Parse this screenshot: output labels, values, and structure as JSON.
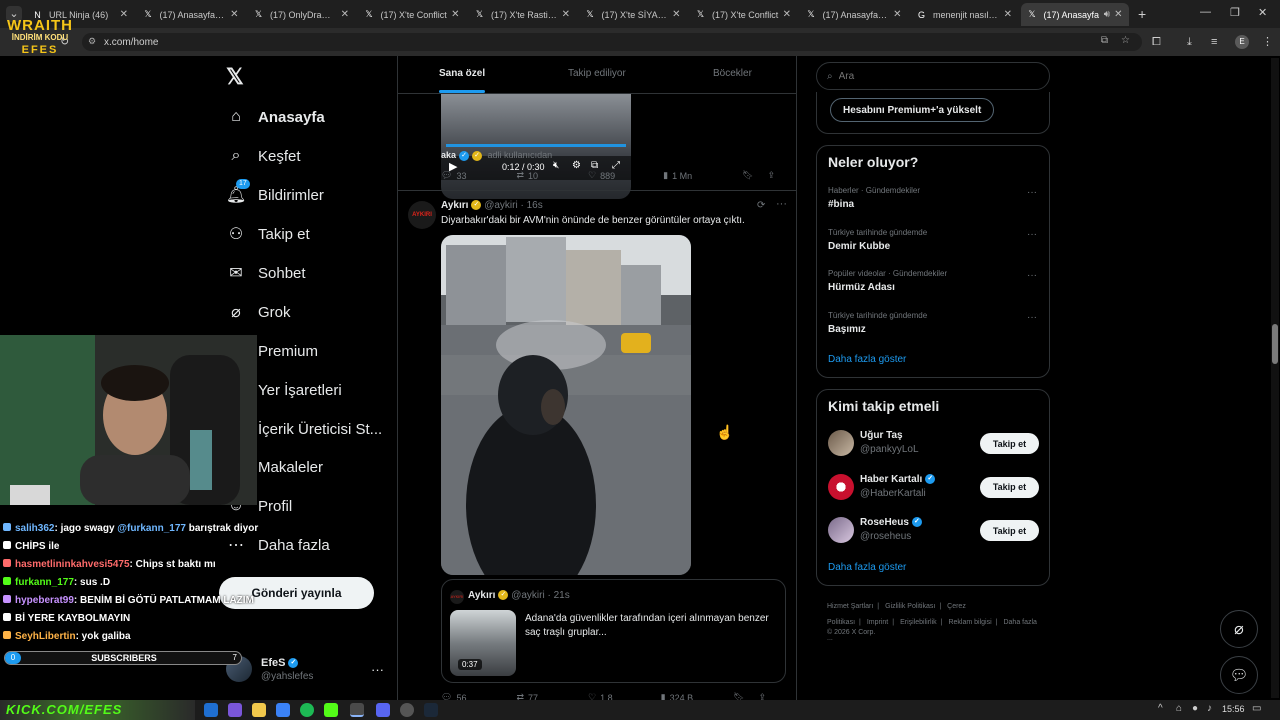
{
  "browser": {
    "tabs": [
      {
        "title": "URL Ninja (46)",
        "active": false
      },
      {
        "title": "(17) Anasayfa / X",
        "active": false
      },
      {
        "title": "(17) OnlyDrama (",
        "active": false
      },
      {
        "title": "(17) X'te Conflict",
        "active": false
      },
      {
        "title": "(17) X'te Rasti Hal",
        "active": false
      },
      {
        "title": "(17) X'te SİYAH Sİ",
        "active": false
      },
      {
        "title": "(17) X'te Conflict",
        "active": false
      },
      {
        "title": "(17) Anasayfa / X",
        "active": false
      },
      {
        "title": "menenjit nasıl bir",
        "active": false
      },
      {
        "title": "(17) Anasayfa",
        "active": true
      }
    ],
    "new_tab": "+",
    "url": "x.com/home",
    "profile_initial": "E"
  },
  "overlay": {
    "brand_line1": "WRAITH",
    "brand_line2": "İNDİRİM KODU",
    "brand_line3": "EFES",
    "subscribers_label": "SUBSCRIBERS",
    "subscribers_left": "0",
    "subscribers_right": "7",
    "bottom_banner": "KICK.COM/EFES",
    "chat": [
      {
        "user": "salih362",
        "user_color": "#6fb7ff",
        "msg": ": jago swagy ",
        "mention": "@furkann_177",
        "rest": " barıştrak diyor"
      },
      {
        "user": "CHİPS ile",
        "user_color": "#ffffff",
        "msg": "",
        "mention": "",
        "rest": ""
      },
      {
        "user": "hasmetlininkahvesi5475",
        "user_color": "#ff6b6b",
        "msg": ": Chips st baktı mı",
        "mention": "",
        "rest": ""
      },
      {
        "user": "furkann_177",
        "user_color": "#53fc18",
        "msg": ": sus .D",
        "mention": "",
        "rest": ""
      },
      {
        "user": "hypeberat99",
        "user_color": "#c792ff",
        "msg": ": BENİM Bİ GÖTÜ PATLATMAM LAZIM",
        "mention": "",
        "rest": ""
      },
      {
        "user": "",
        "user_color": "#ffffff",
        "msg": "Bİ YERE KAYBOLMAYIN",
        "mention": "",
        "rest": ""
      },
      {
        "user": "SeyhLibertin",
        "user_color": "#ffb347",
        "msg": ": yok galiba",
        "mention": "",
        "rest": ""
      }
    ]
  },
  "nav": {
    "items": [
      {
        "label": "Anasayfa",
        "icon": "home-icon",
        "bold": true
      },
      {
        "label": "Keşfet",
        "icon": "search-icon"
      },
      {
        "label": "Bildirimler",
        "icon": "bell-icon",
        "badge": "17"
      },
      {
        "label": "Takip et",
        "icon": "person-add-icon"
      },
      {
        "label": "Sohbet",
        "icon": "mail-icon"
      },
      {
        "label": "Grok",
        "icon": "grok-icon"
      },
      {
        "label": "Premium",
        "icon": "x-premium-icon"
      },
      {
        "label": "Yer İşaretleri",
        "icon": "bookmark-icon"
      },
      {
        "label": "İçerik Üreticisi St...",
        "icon": "creator-icon"
      },
      {
        "label": "Makaleler",
        "icon": "articles-icon"
      },
      {
        "label": "Profil",
        "icon": "profile-icon"
      },
      {
        "label": "Daha fazla",
        "icon": "more-circle-icon"
      }
    ],
    "post_button": "Gönderi yayınla",
    "account_name": "EfeS",
    "account_handle": "@yahslefes"
  },
  "timeline": {
    "tabs": [
      "Sana özel",
      "Takip ediliyor",
      "Böcekler"
    ],
    "video_time": "0:12 / 0:30",
    "prev_post": {
      "author_text": "aka",
      "sub_text": "adli kullanıcıdan",
      "replies": "33",
      "reposts": "10",
      "likes": "889",
      "views": "1 Mn"
    },
    "post": {
      "author": "Aykırı",
      "avatar_text": "AYKIRI",
      "handle": "@aykiri",
      "time": "16s",
      "text": "Diyarbakır'daki bir AVM'nin önünde de benzer görüntüler ortaya çıktı.",
      "quote": {
        "author": "Aykırı",
        "handle": "@aykiri",
        "time": "21s",
        "text": "Adana'da güvenlikler tarafından içeri alınmayan benzer saç traşlı gruplar...",
        "duration": "0:37"
      },
      "replies": "56",
      "reposts": "77",
      "likes": "1,8",
      "views": "324 B"
    }
  },
  "right": {
    "search_placeholder": "Ara",
    "premium_button": "Hesabını Premium+'a yükselt",
    "trends_title": "Neler oluyor?",
    "trends": [
      {
        "meta": "Haberler · Gündemdekiler",
        "name": "#bina"
      },
      {
        "meta": "Türkiye tarihinde gündemde",
        "name": "Demir Kubbe"
      },
      {
        "meta": "Popüler videolar · Gündemdekiler",
        "name": "Hürmüz Adası"
      },
      {
        "meta": "Türkiye tarihinde gündemde",
        "name": "Başımız"
      }
    ],
    "show_more": "Daha fazla göster",
    "follow_title": "Kimi takip etmeli",
    "follow": [
      {
        "name": "Uğur Taş",
        "handle": "@pankyyLoL",
        "verified": false,
        "button": "Takip et"
      },
      {
        "name": "Haber Kartalı",
        "handle": "@HaberKartali",
        "verified": true,
        "button": "Takip et"
      },
      {
        "name": "RoseHeus",
        "handle": "@roseheus",
        "verified": true,
        "button": "Takip et"
      }
    ],
    "follow_more": "Daha fazla göster",
    "footer": [
      "Hizmet Şartları",
      "Gizlilik Politikası",
      "Çerez Politikası",
      "Imprint",
      "Erişilebilirlik",
      "Reklam bilgisi",
      "Daha fazla ..."
    ],
    "copyright": "© 2026 X Corp."
  },
  "taskbar": {
    "time": "15:56"
  }
}
